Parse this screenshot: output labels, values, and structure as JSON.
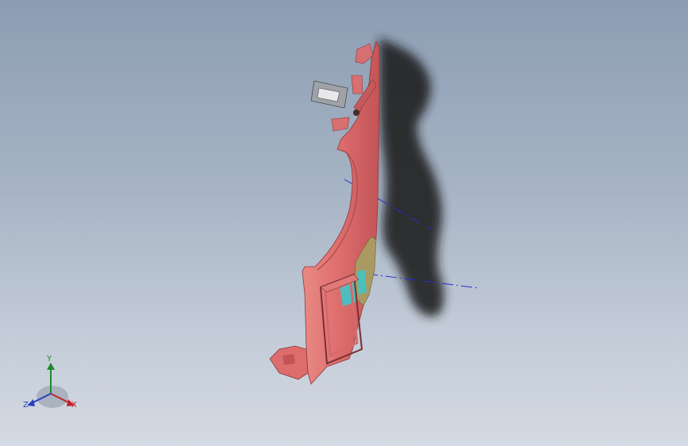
{
  "viewport": {
    "background_top": "#8c9db3",
    "background_bottom": "#d4dae3"
  },
  "model": {
    "part_color": "#dd6c6c",
    "shadow_color": "#1c1c1e",
    "inset_color": "#a89a62",
    "glass_color": "#3fc7c9",
    "reference_axis_color": "#2b2bd6"
  },
  "triad": {
    "x_label": "X",
    "y_label": "Y",
    "z_label": "Z",
    "x_color": "#c0242a",
    "y_color": "#1d8a2a",
    "z_color": "#2a3fc0"
  }
}
